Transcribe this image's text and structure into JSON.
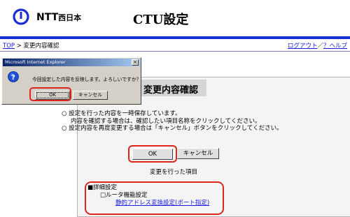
{
  "header": {
    "logo_text": "NTT",
    "logo_sub": "西日本",
    "title": "CTU設定"
  },
  "breadcrumb": {
    "top_link": "TOP",
    "separator": " > ",
    "current": "変更内容確認"
  },
  "nav": {
    "logout": "ログアウト",
    "slash": "／",
    "help": "？ヘルプ"
  },
  "panel": {
    "heading": "変更内容確認",
    "note1_line1": "○ 設定を行った内容を一時保存しています。",
    "note1_line2": "内容を確認する場合は、確認したい項目名称をクリックしてください。",
    "note2": "○ 設定内容を再度変更する場合は「キャンセル」ボタンをクリックしてください。",
    "ok_label": "OK",
    "cancel_label": "キャンセル",
    "changed_label": "変更を行った項目",
    "details_title": "■詳細設定",
    "details_sub": "□ルータ機能設定",
    "details_link": "静的アドレス変換設定(ポート指定)"
  },
  "dialog": {
    "title": "Microsoft Internet Explorer",
    "close_glyph": "×",
    "message": "今回設定した内容を反映します。よろしいですか？",
    "ok_label": "OK",
    "cancel_label": "キャンセル"
  },
  "colors": {
    "accent_bar": "#1a2fd1",
    "highlight": "#e0251b",
    "link": "#1a1ae6"
  }
}
